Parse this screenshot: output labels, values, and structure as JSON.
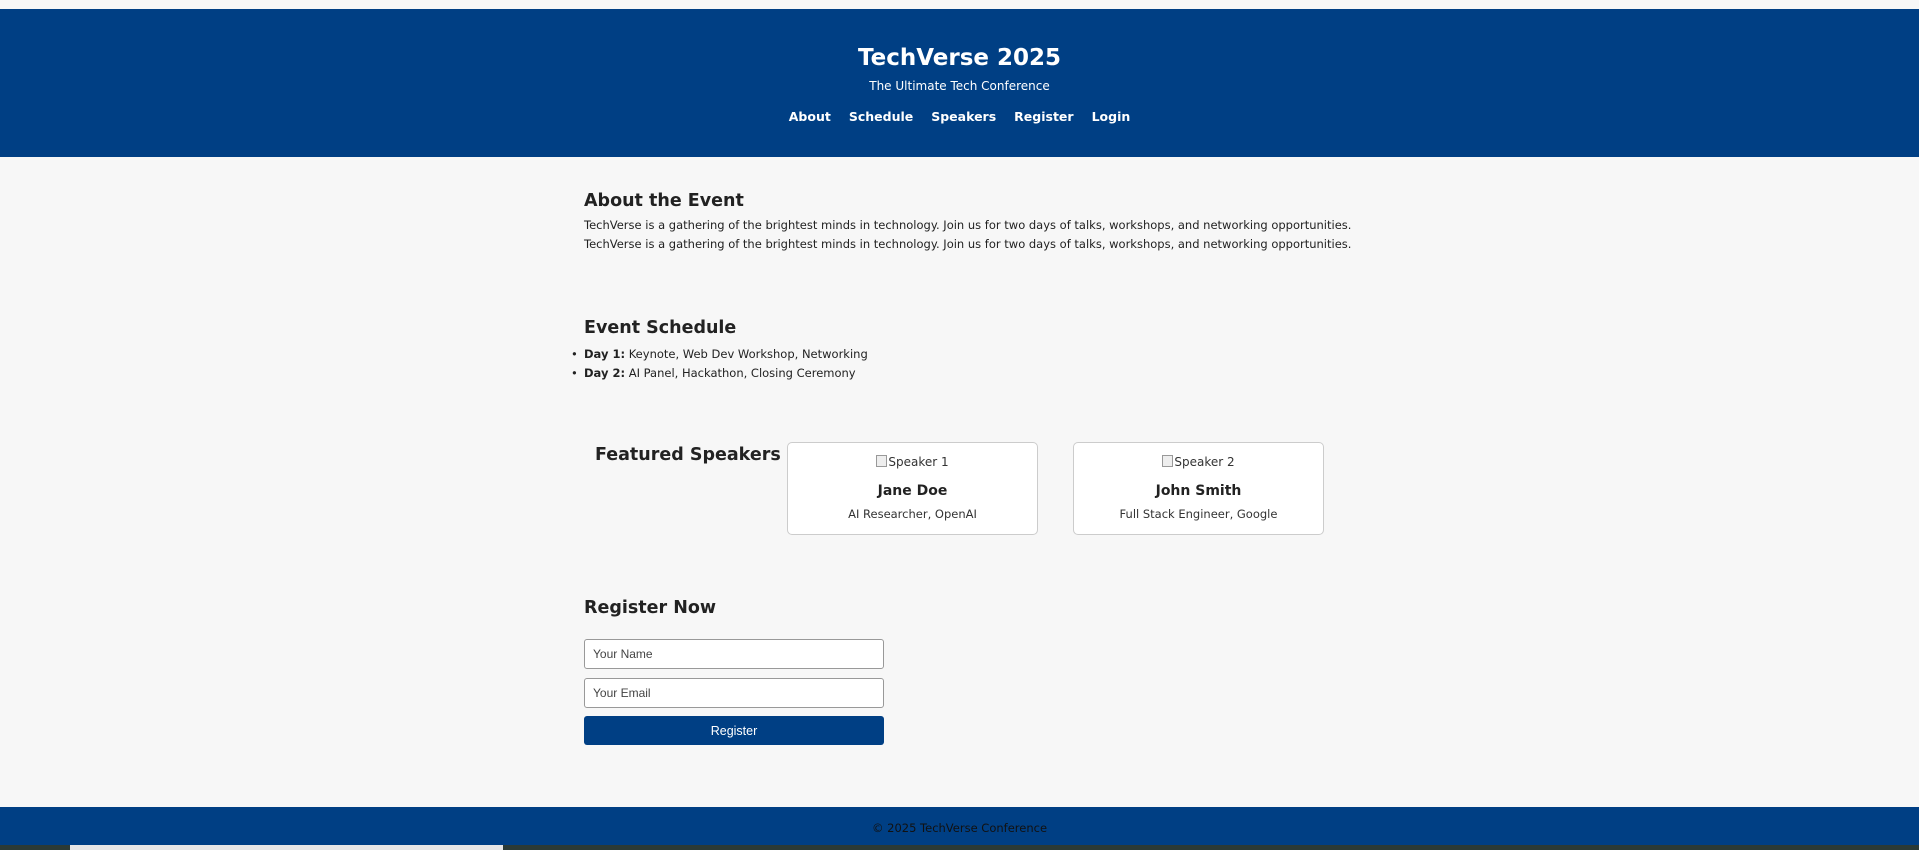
{
  "header": {
    "title": "TechVerse 2025",
    "subtitle": "The Ultimate Tech Conference",
    "nav": [
      "About",
      "Schedule",
      "Speakers",
      "Register",
      "Login"
    ]
  },
  "about": {
    "heading": "About the Event",
    "lines": [
      "TechVerse is a gathering of the brightest minds in technology. Join us for two days of talks, workshops, and networking opportunities.",
      "TechVerse is a gathering of the brightest minds in technology. Join us for two days of talks, workshops, and networking opportunities."
    ]
  },
  "schedule": {
    "heading": "Event Schedule",
    "items": [
      {
        "day": "Day 1:",
        "text": " Keynote, Web Dev Workshop, Networking"
      },
      {
        "day": "Day 2:",
        "text": " AI Panel, Hackathon, Closing Ceremony"
      }
    ]
  },
  "speakers": {
    "heading": "Featured Speakers",
    "cards": [
      {
        "img_alt": "Speaker 1",
        "name": "Jane Doe",
        "role": "AI Researcher, OpenAI"
      },
      {
        "img_alt": "Speaker 2",
        "name": "John Smith",
        "role": "Full Stack Engineer, Google"
      }
    ]
  },
  "register": {
    "heading": "Register Now",
    "name_placeholder": "Your Name",
    "email_placeholder": "Your Email",
    "button_label": "Register"
  },
  "footer": {
    "copyright": "© 2025 TechVerse Conference"
  },
  "colors": {
    "brand": "#003f84",
    "background": "#f7f7f7"
  }
}
